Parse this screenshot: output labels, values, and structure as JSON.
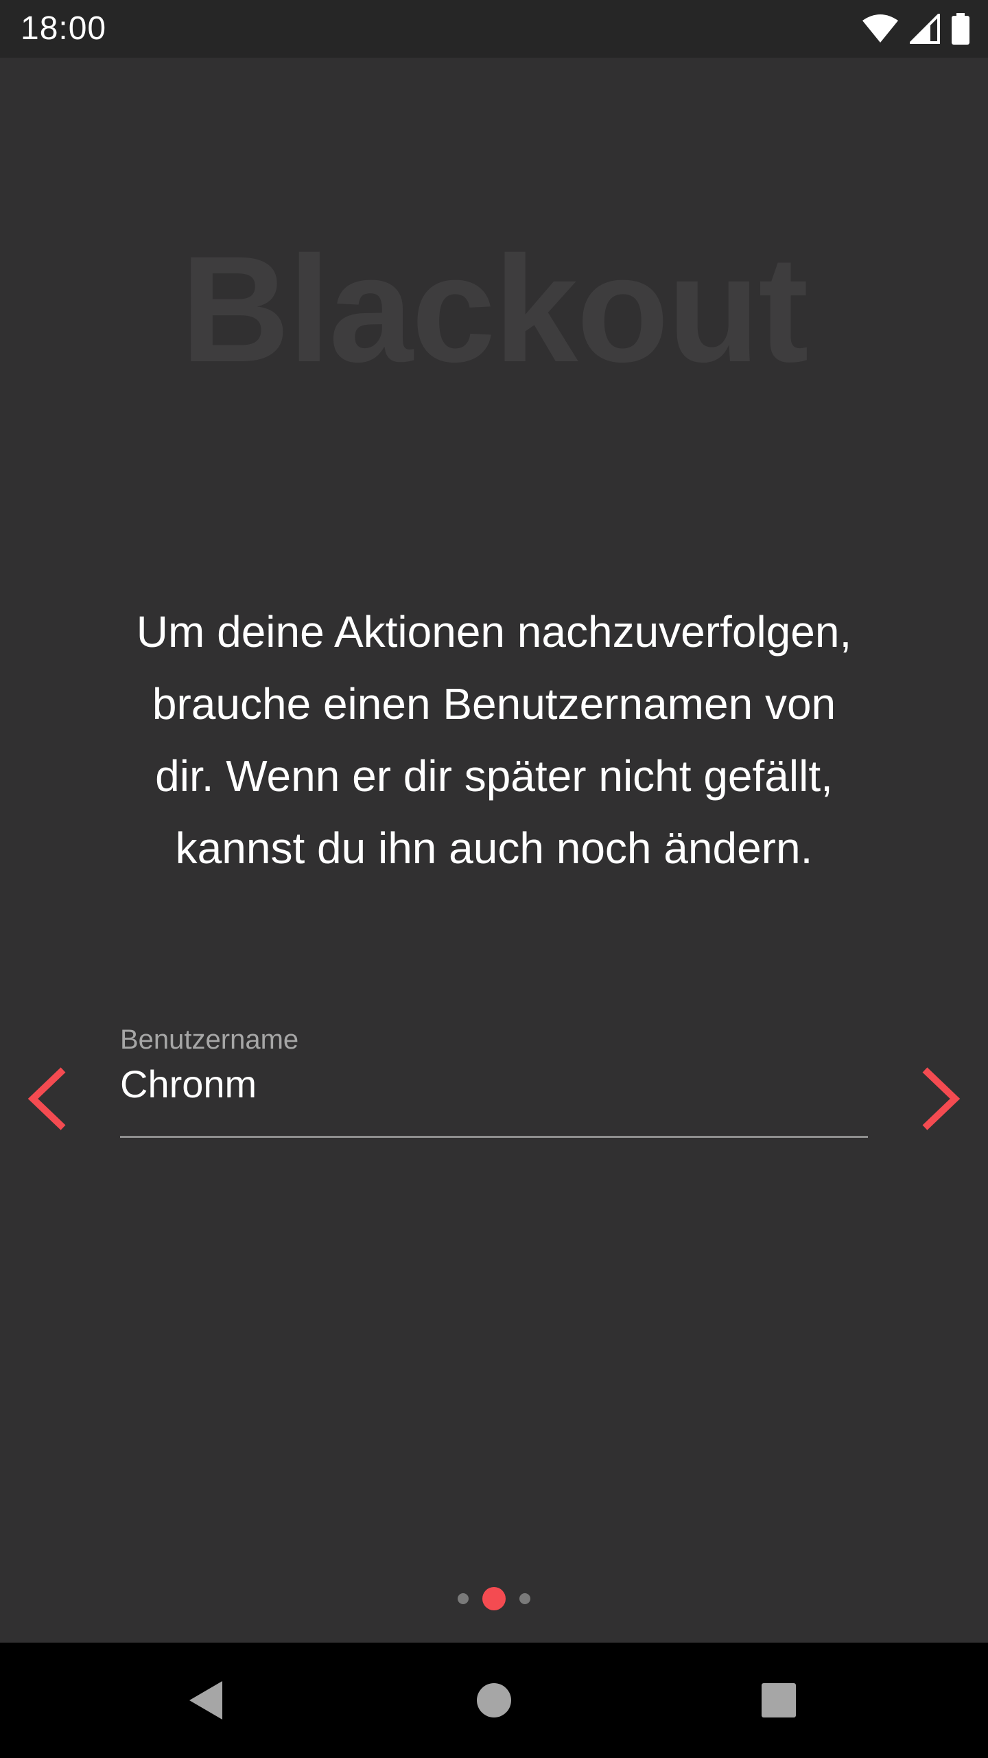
{
  "status_bar": {
    "time": "18:00",
    "icons": [
      "wifi-icon",
      "cell-signal-icon",
      "battery-icon"
    ]
  },
  "logo": {
    "text": "Blackout"
  },
  "message": {
    "line1": "Um deine Aktionen nachzuverfolgen,",
    "line2": "brauche einen Benutzernamen von",
    "line3": "dir. Wenn er dir später nicht gefällt,",
    "line4": "kannst du ihn auch noch ändern."
  },
  "username_field": {
    "label": "Benutzername",
    "value": "Chronm"
  },
  "navigation": {
    "prev_icon": "chevron-left-icon",
    "next_icon": "chevron-right-icon",
    "page_count": 3,
    "active_page": 2
  },
  "colors": {
    "accent": "#f44b51",
    "background": "#313031",
    "status_bar": "#262626",
    "logo": "#3e3d3e",
    "text": "#ffffff",
    "label": "#a6a6a6"
  },
  "system_nav": {
    "icons": [
      "back-icon",
      "home-icon",
      "recents-icon"
    ]
  }
}
